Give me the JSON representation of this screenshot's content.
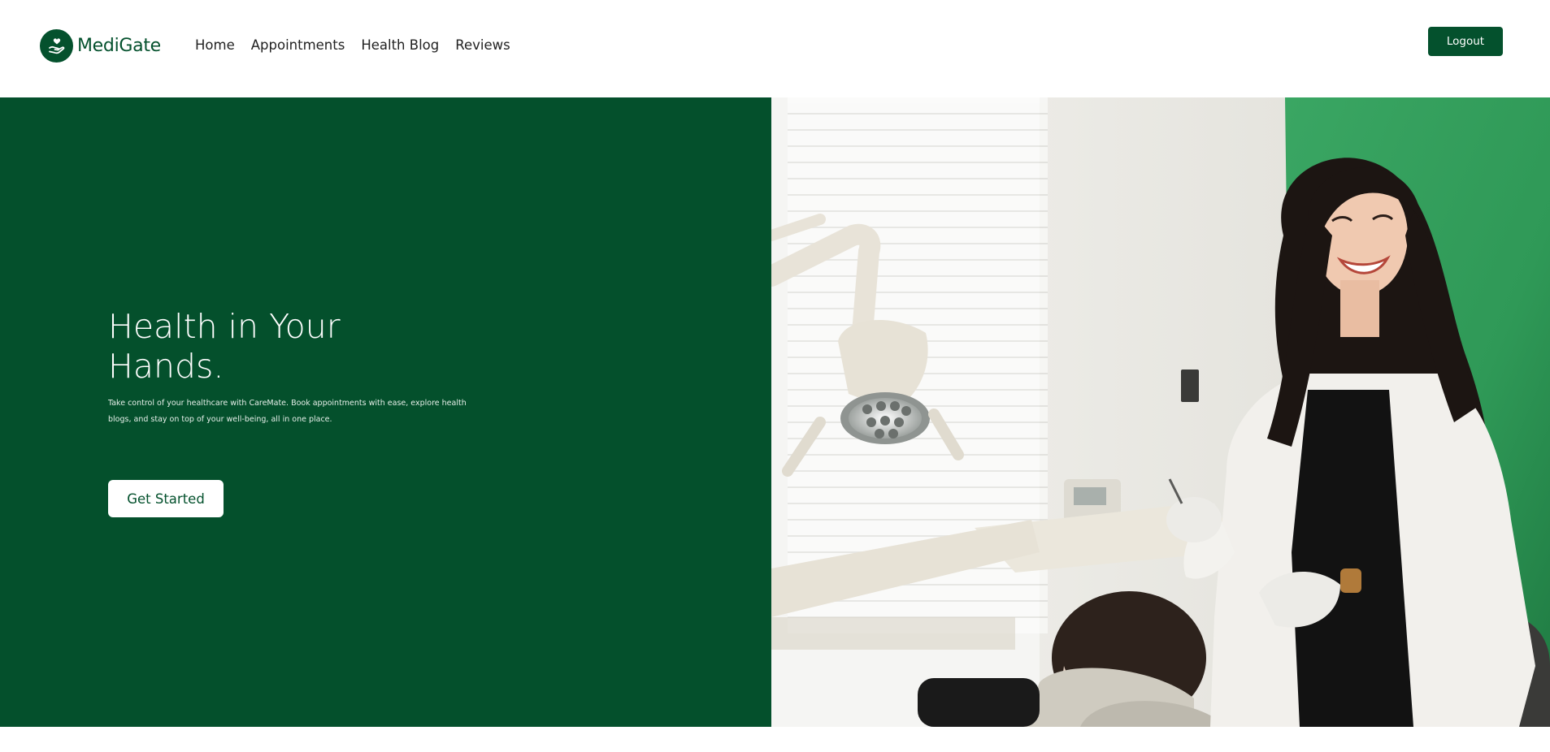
{
  "brand": {
    "name": "MediGate",
    "logo_icon": "hand-heart-icon",
    "color": "#04512d"
  },
  "nav": {
    "items": [
      {
        "label": "Home"
      },
      {
        "label": "Appointments"
      },
      {
        "label": "Health Blog"
      },
      {
        "label": "Reviews"
      }
    ]
  },
  "header": {
    "logout_label": "Logout"
  },
  "hero": {
    "title": "Health in Your Hands.",
    "description": "Take control of your healthcare with CareMate. Book appointments with ease, explore health blogs, and stay on top of your well-being, all in one place.",
    "cta_label": "Get Started",
    "background_color": "#04502c",
    "image_alt": "Smiling dentist in a white coat standing beside a patient in a dental chair"
  }
}
